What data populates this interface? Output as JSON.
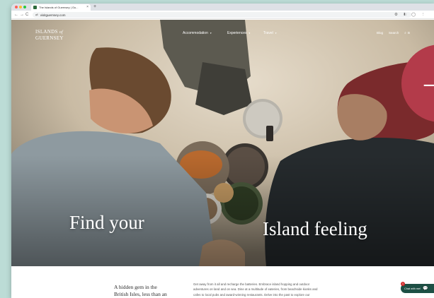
{
  "browser": {
    "tab_title": "The Islands of Guernsey | Gu...",
    "tab_close": "×",
    "new_tab": "+",
    "url": "visitguernsey.com",
    "nav_back": "←",
    "nav_forward": "→",
    "nav_reload": "C"
  },
  "site_header": {
    "logo_line1": "ISLANDS",
    "logo_of": "of",
    "logo_line2": "GUERNSEY",
    "nav": [
      {
        "label": "Accommodation"
      },
      {
        "label": "Experiences"
      },
      {
        "label": "Travel"
      }
    ],
    "caret": "▾",
    "blog": "Blog",
    "search": "Search",
    "more": "B"
  },
  "hero": {
    "headline_left": "Find your",
    "headline_right": "Island feeling",
    "circle_icon": "+"
  },
  "intro": {
    "heading_line1": "A hidden gem in the",
    "heading_line2": "British Isles, less than an",
    "body_line1": "Get away from it all and recharge the batteries. Embrace island hopping and outdoor",
    "body_line2": "adventures on land and on sea. Dine at a multitude of eateries, from beachside kiosks and",
    "body_line3": "cafes to local pubs and award-winning restaurants. Delve into the past to explore our"
  },
  "chat": {
    "label": "Chat with me!",
    "badge": "1",
    "icon": "💬"
  },
  "colors": {
    "accent": "#b33b4a",
    "chat_bg": "#1d4f44",
    "page_bg": "#bcdcd6"
  }
}
